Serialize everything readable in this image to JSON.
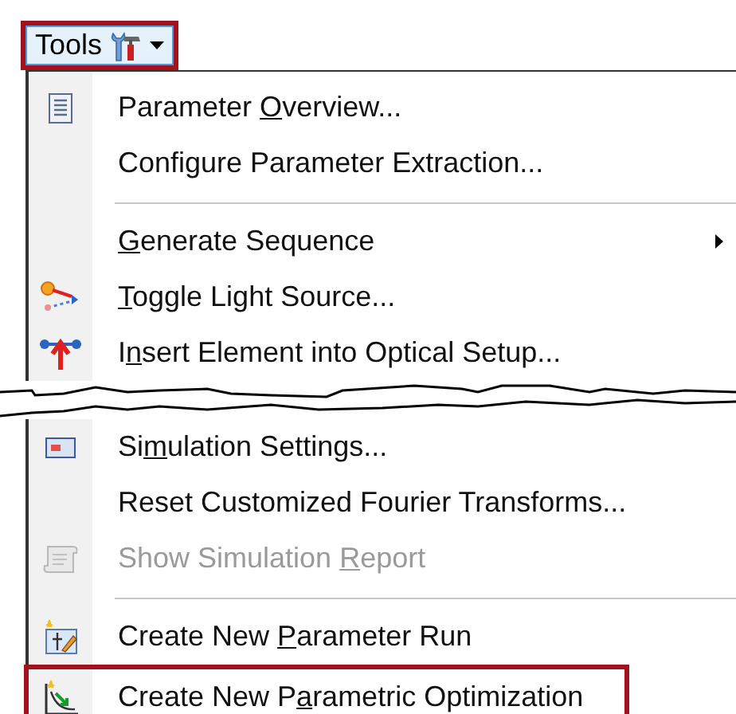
{
  "tools_button": {
    "label": "Tools",
    "highlighted": true
  },
  "menu": [
    {
      "kind": "item",
      "parts": [
        {
          "text": "Parameter ",
          "access_key": false
        },
        {
          "text": "O",
          "access_key": true
        },
        {
          "text": "verview...",
          "access_key": false
        }
      ],
      "disabled": false,
      "submenu": false,
      "highlighted": false
    },
    {
      "kind": "item",
      "parts": [
        {
          "text": "Configure Parameter Extraction...",
          "access_key": false
        }
      ],
      "disabled": false,
      "submenu": false,
      "highlighted": false
    },
    {
      "kind": "separator"
    },
    {
      "kind": "item",
      "parts": [
        {
          "text": "G",
          "access_key": true
        },
        {
          "text": "enerate Sequence",
          "access_key": false
        }
      ],
      "disabled": false,
      "submenu": true,
      "highlighted": false
    },
    {
      "kind": "item",
      "parts": [
        {
          "text": "T",
          "access_key": true
        },
        {
          "text": "oggle Light Source...",
          "access_key": false
        }
      ],
      "disabled": false,
      "submenu": false,
      "highlighted": false
    },
    {
      "kind": "item",
      "parts": [
        {
          "text": "I",
          "access_key": false
        },
        {
          "text": "n",
          "access_key": true
        },
        {
          "text": "sert Element into Optical Setup...",
          "access_key": false
        }
      ],
      "disabled": false,
      "submenu": false,
      "highlighted": false
    },
    {
      "kind": "tear"
    },
    {
      "kind": "item",
      "parts": [
        {
          "text": "Si",
          "access_key": false
        },
        {
          "text": "m",
          "access_key": true
        },
        {
          "text": "ulation Settings...",
          "access_key": false
        }
      ],
      "disabled": false,
      "submenu": false,
      "highlighted": false
    },
    {
      "kind": "item",
      "parts": [
        {
          "text": "Reset Customized Fourier Transforms...",
          "access_key": false
        }
      ],
      "disabled": false,
      "submenu": false,
      "highlighted": false
    },
    {
      "kind": "item",
      "parts": [
        {
          "text": "Show Simulation ",
          "access_key": false
        },
        {
          "text": "R",
          "access_key": true
        },
        {
          "text": "eport",
          "access_key": false
        }
      ],
      "disabled": true,
      "submenu": false,
      "highlighted": false
    },
    {
      "kind": "separator"
    },
    {
      "kind": "item",
      "parts": [
        {
          "text": "Create New ",
          "access_key": false
        },
        {
          "text": "P",
          "access_key": true
        },
        {
          "text": "arameter Run",
          "access_key": false
        }
      ],
      "disabled": false,
      "submenu": false,
      "highlighted": false
    },
    {
      "kind": "item",
      "parts": [
        {
          "text": "Create New P",
          "access_key": false
        },
        {
          "text": "a",
          "access_key": true
        },
        {
          "text": "rametric Optimization",
          "access_key": false
        }
      ],
      "disabled": false,
      "submenu": false,
      "highlighted": true
    }
  ]
}
